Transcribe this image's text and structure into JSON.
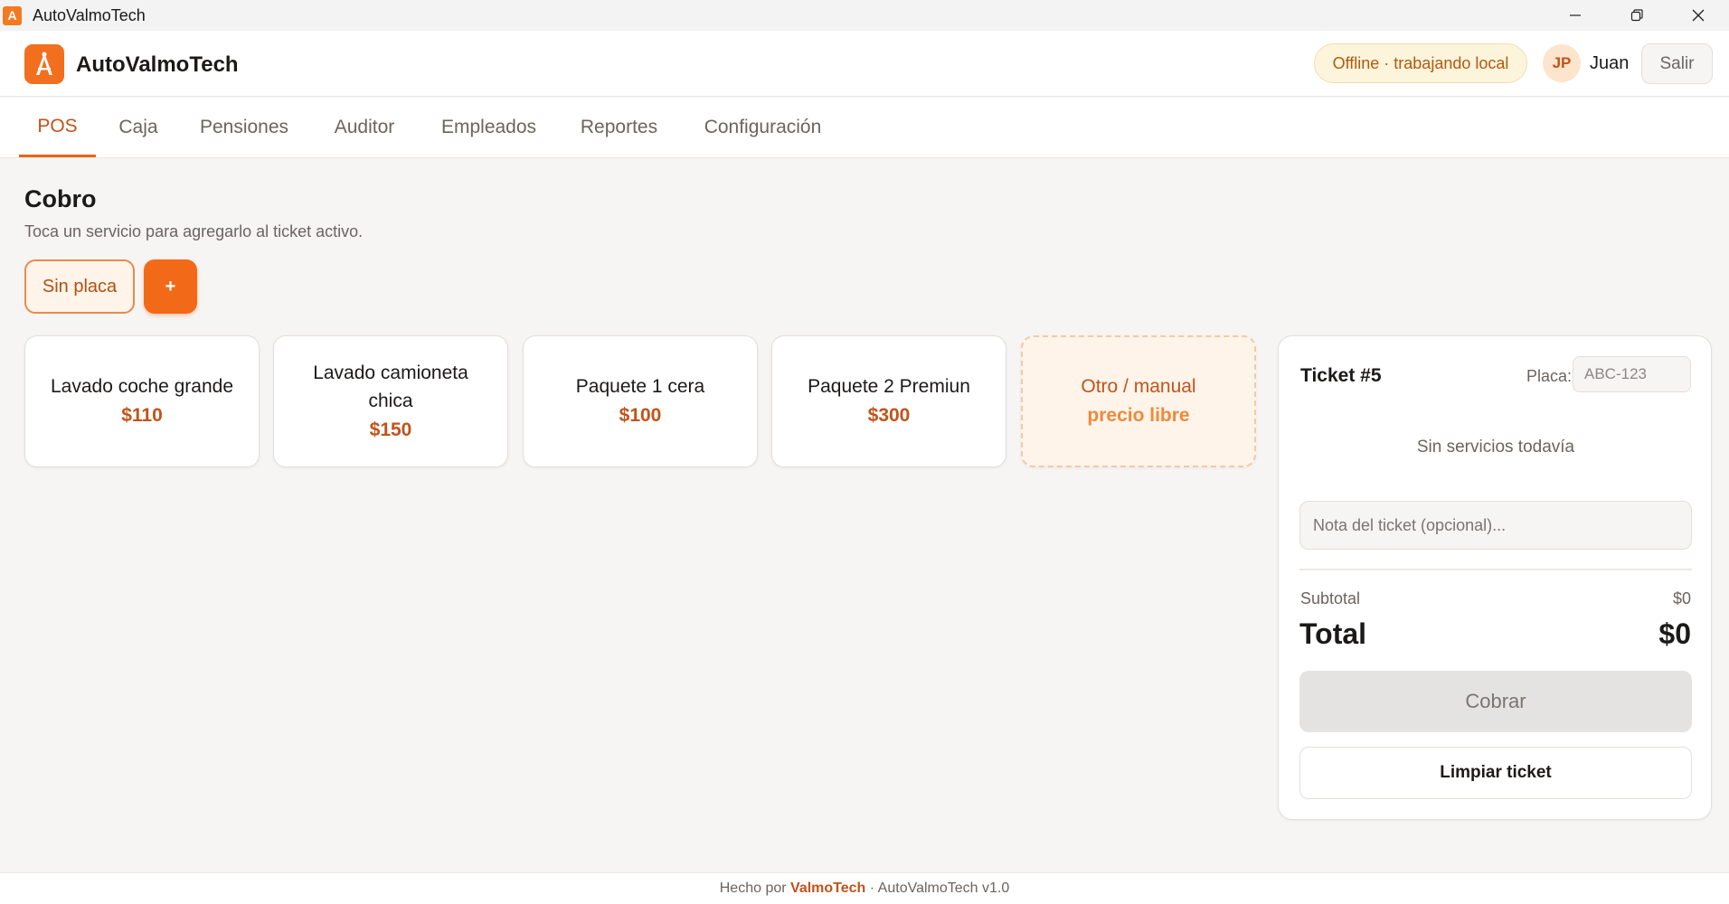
{
  "window": {
    "title": "AutoValmoTech",
    "app_icon_letter": "A",
    "controls": [
      "minimize-icon",
      "restore-icon",
      "close-icon"
    ]
  },
  "header": {
    "brand": "AutoValmoTech",
    "logo_icon": "lamp-icon",
    "status_badge": "Offline · trabajando local",
    "user_initials": "JP",
    "user_name": "Juan",
    "logout_label": "Salir"
  },
  "tabs": [
    {
      "label": "POS",
      "active": true
    },
    {
      "label": "Caja",
      "active": false
    },
    {
      "label": "Pensiones",
      "active": false
    },
    {
      "label": "Auditor",
      "active": false
    },
    {
      "label": "Empleados",
      "active": false
    },
    {
      "label": "Reportes",
      "active": false
    },
    {
      "label": "Configuración",
      "active": false
    }
  ],
  "main": {
    "title": "Cobro",
    "subtitle": "Toca un servicio para agregarlo al ticket activo.",
    "plate_button": "Sin placa",
    "add_button": "+"
  },
  "services": [
    {
      "name": "Lavado coche grande",
      "price": "$110"
    },
    {
      "name": "Lavado camioneta chica",
      "price": "$150"
    },
    {
      "name": "Paquete 1 cera",
      "price": "$100"
    },
    {
      "name": "Paquete 2 Premiun",
      "price": "$300"
    },
    {
      "name": "Otro / manual",
      "price": "precio libre"
    }
  ],
  "ticket": {
    "title": "Ticket #5",
    "plate_label": "Placa:",
    "plate_placeholder": "ABC-123",
    "empty_message": "Sin servicios todavía",
    "note_placeholder": "Nota del ticket (opcional)...",
    "subtotal_label": "Subtotal",
    "subtotal_value": "$0",
    "total_label": "Total",
    "total_value": "$0",
    "charge_label": "Cobrar",
    "clear_label": "Limpiar ticket"
  },
  "footer": {
    "prefix": "Hecho por",
    "brand": "ValmoTech",
    "suffix": "· AutoValmoTech v1.0"
  },
  "colors": {
    "accent": "#f26a18",
    "accent_text": "#c2531a",
    "background": "#f6f5f4"
  }
}
